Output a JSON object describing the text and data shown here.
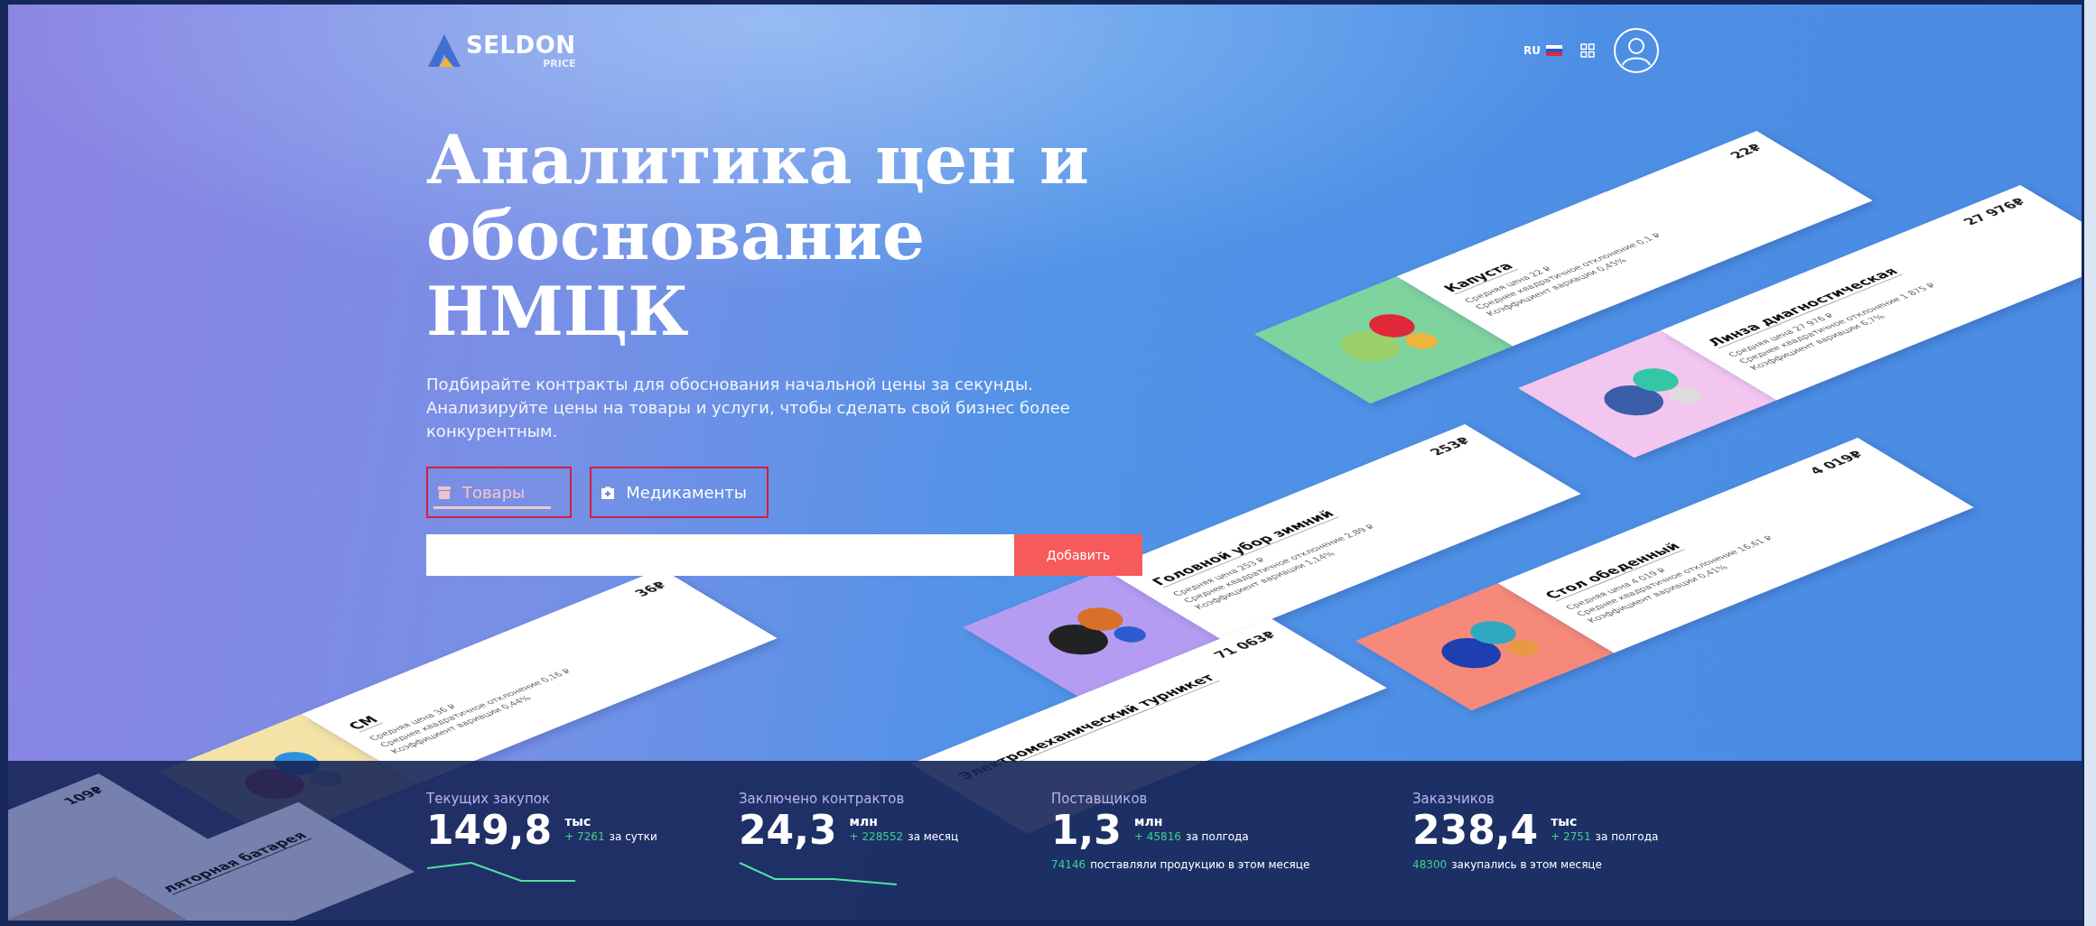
{
  "header": {
    "logo": {
      "name": "SELDON",
      "sub": "PRICE"
    },
    "language": "RU"
  },
  "hero": {
    "title": "Аналитика цен и обоснование НМЦК",
    "subtitle": "Подбирайте контракты для обоснования начальной цены за секунды. Анализируйте цены на товары и услуги, чтобы сделать свой бизнес более конкурентным.",
    "tabs": [
      {
        "label": "Товары",
        "selected": true
      },
      {
        "label": "Медикаменты",
        "selected": false
      }
    ],
    "search": {
      "button": "Добавить"
    }
  },
  "cards": [
    {
      "title": "Капуста",
      "price": "22₽",
      "color": "#7fd39e",
      "lines": [
        "Средняя цена 22 ₽",
        "Среднее квадратичное отклонение 0,1 ₽",
        "Коэффициент вариации 0,45%"
      ]
    },
    {
      "title": "Линза диагностическая",
      "price": "27 976₽",
      "color": "#f3c6f0",
      "lines": [
        "Средняя цена 27 976 ₽",
        "Среднее квадратичное отклонение 1 875 ₽",
        "Коэффициент вариации 6,7%"
      ]
    },
    {
      "title": "Головной убор зимний",
      "price": "253₽",
      "color": "#b49cf2",
      "lines": [
        "Средняя цена 253 ₽",
        "Среднее квадратичное отклонение 2,89 ₽",
        "Коэффициент вариации 1,14%"
      ]
    },
    {
      "title": "Стол обеденный",
      "price": "4 019₽",
      "color": "#f6897a",
      "lines": [
        "Средняя цена 4 019 ₽",
        "Среднее квадратичное отклонение 16,61 ₽",
        "Коэффициент вариации 0,41%"
      ]
    },
    {
      "title": "СМ",
      "price": "36₽",
      "color": "#f3e3a6",
      "lines": [
        "Средняя цена 36 ₽",
        "Среднее квадратичное отклонение 0,16 ₽",
        "Коэффициент вариации 0,44%"
      ]
    },
    {
      "title": "Электромеханический турникет",
      "price": "71 063₽"
    },
    {
      "price": "109₽"
    },
    {
      "title": "ляторная батарея",
      "color": "#6f6a8c"
    }
  ],
  "stats": [
    {
      "kind": "trend",
      "label": "Текущих закупок",
      "value": "149,8",
      "unit": "тыс",
      "delta": "+ 7261",
      "period": "за сутки"
    },
    {
      "kind": "trend",
      "label": "Заключено контрактов",
      "value": "24,3",
      "unit": "млн",
      "delta": "+ 228552",
      "period": "за месяц"
    },
    {
      "kind": "note",
      "label": "Поставщиков",
      "value": "1,3",
      "unit": "млн",
      "delta": "+ 45816",
      "period": "за полгода",
      "note_count": "74146",
      "note_text": "поставляли продукцию в этом месяце"
    },
    {
      "kind": "note",
      "label": "Заказчиков",
      "value": "238,4",
      "unit": "тыс",
      "delta": "+ 2751",
      "period": "за полгода",
      "note_count": "48300",
      "note_text": "закупались в этом месяце"
    }
  ]
}
